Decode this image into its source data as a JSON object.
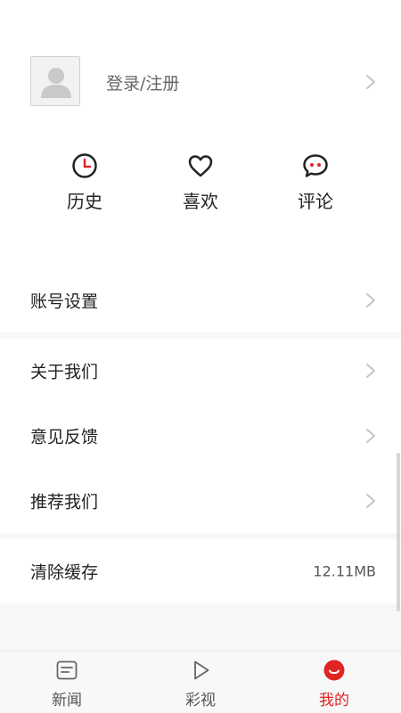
{
  "profile": {
    "login_label": "登录/注册",
    "avatar_icon": "user-placeholder-icon"
  },
  "quick_actions": [
    {
      "label": "历史",
      "icon": "clock-icon"
    },
    {
      "label": "喜欢",
      "icon": "heart-icon"
    },
    {
      "label": "评论",
      "icon": "chat-bubble-icon"
    }
  ],
  "menu": {
    "account_settings": "账号设置",
    "about_us": "关于我们",
    "feedback": "意见反馈",
    "recommend_us": "推荐我们",
    "clear_cache": "清除缓存",
    "cache_size": "12.11MB"
  },
  "tabs": [
    {
      "label": "新闻",
      "icon": "news-icon",
      "active": false
    },
    {
      "label": "彩视",
      "icon": "play-icon",
      "active": false
    },
    {
      "label": "我的",
      "icon": "smile-icon",
      "active": true
    }
  ],
  "colors": {
    "accent": "#e02424",
    "icon_dark": "#222222",
    "chevron": "#c4c4c4",
    "divider_bg": "#f7f7f7"
  }
}
